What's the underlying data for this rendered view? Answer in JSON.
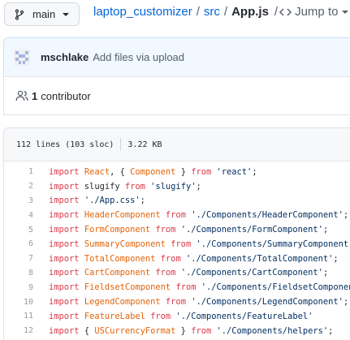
{
  "branch": {
    "name": "main",
    "icon": "git-branch-icon"
  },
  "breadcrumb": {
    "repo": "laptop_customizer",
    "sep1": "/",
    "dir": "src",
    "sep2": "/",
    "file": "App.js",
    "sep3": "/",
    "jump_label": "Jump to"
  },
  "commit": {
    "author": "mschlake",
    "message": "Add files via upload"
  },
  "contributors": {
    "count": "1",
    "label": "contributor"
  },
  "file_info": {
    "lines": "112 lines (103 sloc)",
    "size": "3.22 KB"
  },
  "code_lines": [
    {
      "n": "1",
      "tokens": [
        [
          "kw",
          "import"
        ],
        [
          "pl",
          " "
        ],
        [
          "id",
          "React"
        ],
        [
          "pl",
          ", { "
        ],
        [
          "id",
          "Component"
        ],
        [
          "pl",
          " } "
        ],
        [
          "kw",
          "from"
        ],
        [
          "pl",
          " "
        ],
        [
          "st",
          "'react'"
        ],
        [
          "pl",
          ";"
        ]
      ]
    },
    {
      "n": "2",
      "tokens": [
        [
          "kw",
          "import"
        ],
        [
          "pl",
          " slugify "
        ],
        [
          "kw",
          "from"
        ],
        [
          "pl",
          " "
        ],
        [
          "st",
          "'slugify'"
        ],
        [
          "pl",
          ";"
        ]
      ]
    },
    {
      "n": "3",
      "tokens": [
        [
          "kw",
          "import"
        ],
        [
          "pl",
          " "
        ],
        [
          "st",
          "'./App.css'"
        ],
        [
          "pl",
          ";"
        ]
      ]
    },
    {
      "n": "4",
      "tokens": [
        [
          "kw",
          "import"
        ],
        [
          "pl",
          " "
        ],
        [
          "id",
          "HeaderComponent"
        ],
        [
          "pl",
          " "
        ],
        [
          "kw",
          "from"
        ],
        [
          "pl",
          " "
        ],
        [
          "st",
          "'./Components/HeaderComponent'"
        ],
        [
          "pl",
          ";"
        ]
      ]
    },
    {
      "n": "5",
      "tokens": [
        [
          "kw",
          "import"
        ],
        [
          "pl",
          " "
        ],
        [
          "id",
          "FormComponent"
        ],
        [
          "pl",
          " "
        ],
        [
          "kw",
          "from"
        ],
        [
          "pl",
          " "
        ],
        [
          "st",
          "'./Components/FormComponent'"
        ],
        [
          "pl",
          ";"
        ]
      ]
    },
    {
      "n": "6",
      "tokens": [
        [
          "kw",
          "import"
        ],
        [
          "pl",
          " "
        ],
        [
          "id",
          "SummaryComponent"
        ],
        [
          "pl",
          " "
        ],
        [
          "kw",
          "from"
        ],
        [
          "pl",
          " "
        ],
        [
          "st",
          "'./Components/SummaryComponent'"
        ],
        [
          "pl",
          ";"
        ]
      ]
    },
    {
      "n": "7",
      "tokens": [
        [
          "kw",
          "import"
        ],
        [
          "pl",
          " "
        ],
        [
          "id",
          "TotalComponent"
        ],
        [
          "pl",
          " "
        ],
        [
          "kw",
          "from"
        ],
        [
          "pl",
          " "
        ],
        [
          "st",
          "'./Components/TotalComponent'"
        ],
        [
          "pl",
          ";"
        ]
      ]
    },
    {
      "n": "8",
      "tokens": [
        [
          "kw",
          "import"
        ],
        [
          "pl",
          " "
        ],
        [
          "id",
          "CartComponent"
        ],
        [
          "pl",
          " "
        ],
        [
          "kw",
          "from"
        ],
        [
          "pl",
          " "
        ],
        [
          "st",
          "'./Components/CartComponent'"
        ],
        [
          "pl",
          ";"
        ]
      ]
    },
    {
      "n": "9",
      "tokens": [
        [
          "kw",
          "import"
        ],
        [
          "pl",
          " "
        ],
        [
          "id",
          "FieldsetComponent"
        ],
        [
          "pl",
          " "
        ],
        [
          "kw",
          "from"
        ],
        [
          "pl",
          " "
        ],
        [
          "st",
          "'./Components/FieldsetComponent'"
        ]
      ]
    },
    {
      "n": "10",
      "tokens": [
        [
          "kw",
          "import"
        ],
        [
          "pl",
          " "
        ],
        [
          "id",
          "LegendComponent"
        ],
        [
          "pl",
          " "
        ],
        [
          "kw",
          "from"
        ],
        [
          "pl",
          " "
        ],
        [
          "st",
          "'./Components/LegendComponent'"
        ],
        [
          "pl",
          ";"
        ]
      ]
    },
    {
      "n": "11",
      "tokens": [
        [
          "kw",
          "import"
        ],
        [
          "pl",
          " "
        ],
        [
          "id",
          "FeatureLabel"
        ],
        [
          "pl",
          " "
        ],
        [
          "kw",
          "from"
        ],
        [
          "pl",
          " "
        ],
        [
          "st",
          "'./Components/FeatureLabel'"
        ]
      ]
    },
    {
      "n": "12",
      "tokens": [
        [
          "kw",
          "import"
        ],
        [
          "pl",
          " { "
        ],
        [
          "id",
          "USCurrencyFormat"
        ],
        [
          "pl",
          " } "
        ],
        [
          "kw",
          "from"
        ],
        [
          "pl",
          " "
        ],
        [
          "st",
          "'./Components/helpers'"
        ],
        [
          "pl",
          ";"
        ]
      ]
    }
  ],
  "colors": {
    "link": "#0366d6",
    "keyword": "#d73a49",
    "identifier": "#e36209",
    "string": "#032f62"
  }
}
